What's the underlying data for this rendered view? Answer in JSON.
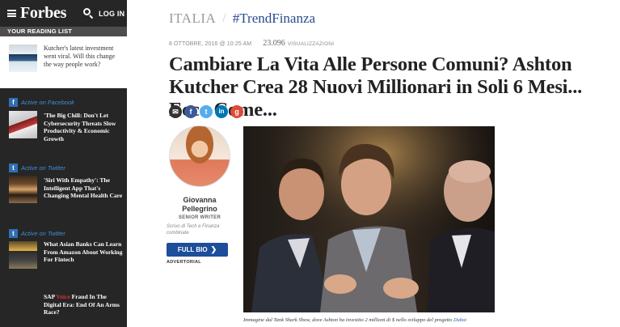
{
  "header": {
    "logo": "Forbes",
    "login_label": "LOG IN"
  },
  "reading_list": {
    "title": "YOUR READING LIST",
    "item_text": "Kutcher's latest investment went viral. Will this change the way people work?"
  },
  "feed": [
    {
      "source": "Active on Facebook",
      "badge": "f",
      "title": "'The Big Chill: Don't Let Cybersecurity Threats Slow Productivity & Economic Growth"
    },
    {
      "source": "Active on Twitter",
      "badge": "t",
      "title": "'Siri With Empathy': The Intelligent App That's Changing Mental Health Care"
    },
    {
      "source": "Active on Twitter",
      "badge": "t",
      "title": "What Asian Banks Can Learn From Amazon About Working For Fintech"
    }
  ],
  "sap_promo": {
    "brand": "SAP",
    "brand_suffix": "Voice",
    "title": "Fraud In The Digital Era: End Of An Arms Race?"
  },
  "article": {
    "category": "ITALIA",
    "separator": "/",
    "tag": "#TrendFinanza",
    "date": "8 OTTOBRE, 2016 @ 10:25 AM",
    "views": "23.096",
    "views_label": "VISUALIZZAZIONI",
    "headline": "Cambiare La Vita Alle Persone Comuni? Ashton Kutcher Crea 28 Nuovi Millionari in Soli 6 Mesi... Ecco Come...",
    "caption": "Immagine dal Tank Shark Show, dove Ashton ha investito 2 millioni di $ nello sviluppo del progetto",
    "caption_link": "Dubai"
  },
  "share": {
    "mail": "✉",
    "facebook": "f",
    "twitter": "t",
    "linkedin": "in",
    "google": "g"
  },
  "author": {
    "name": "Giovanna Pellegrino",
    "role": "SENIOR WRITER",
    "bio": "Scrivo di Tech e Finanza combinate",
    "fullbio_label": "FULL BIO",
    "fullbio_chevron": "❯",
    "advertorial": "ADVERTORIAL"
  },
  "colors": {
    "sidebar_bg": "#262626",
    "accent_blue": "#1c4e9a",
    "tag_blue": "#2a4b8d",
    "feed_label_blue": "#3e8ed8",
    "sap_red": "#e0302e"
  }
}
